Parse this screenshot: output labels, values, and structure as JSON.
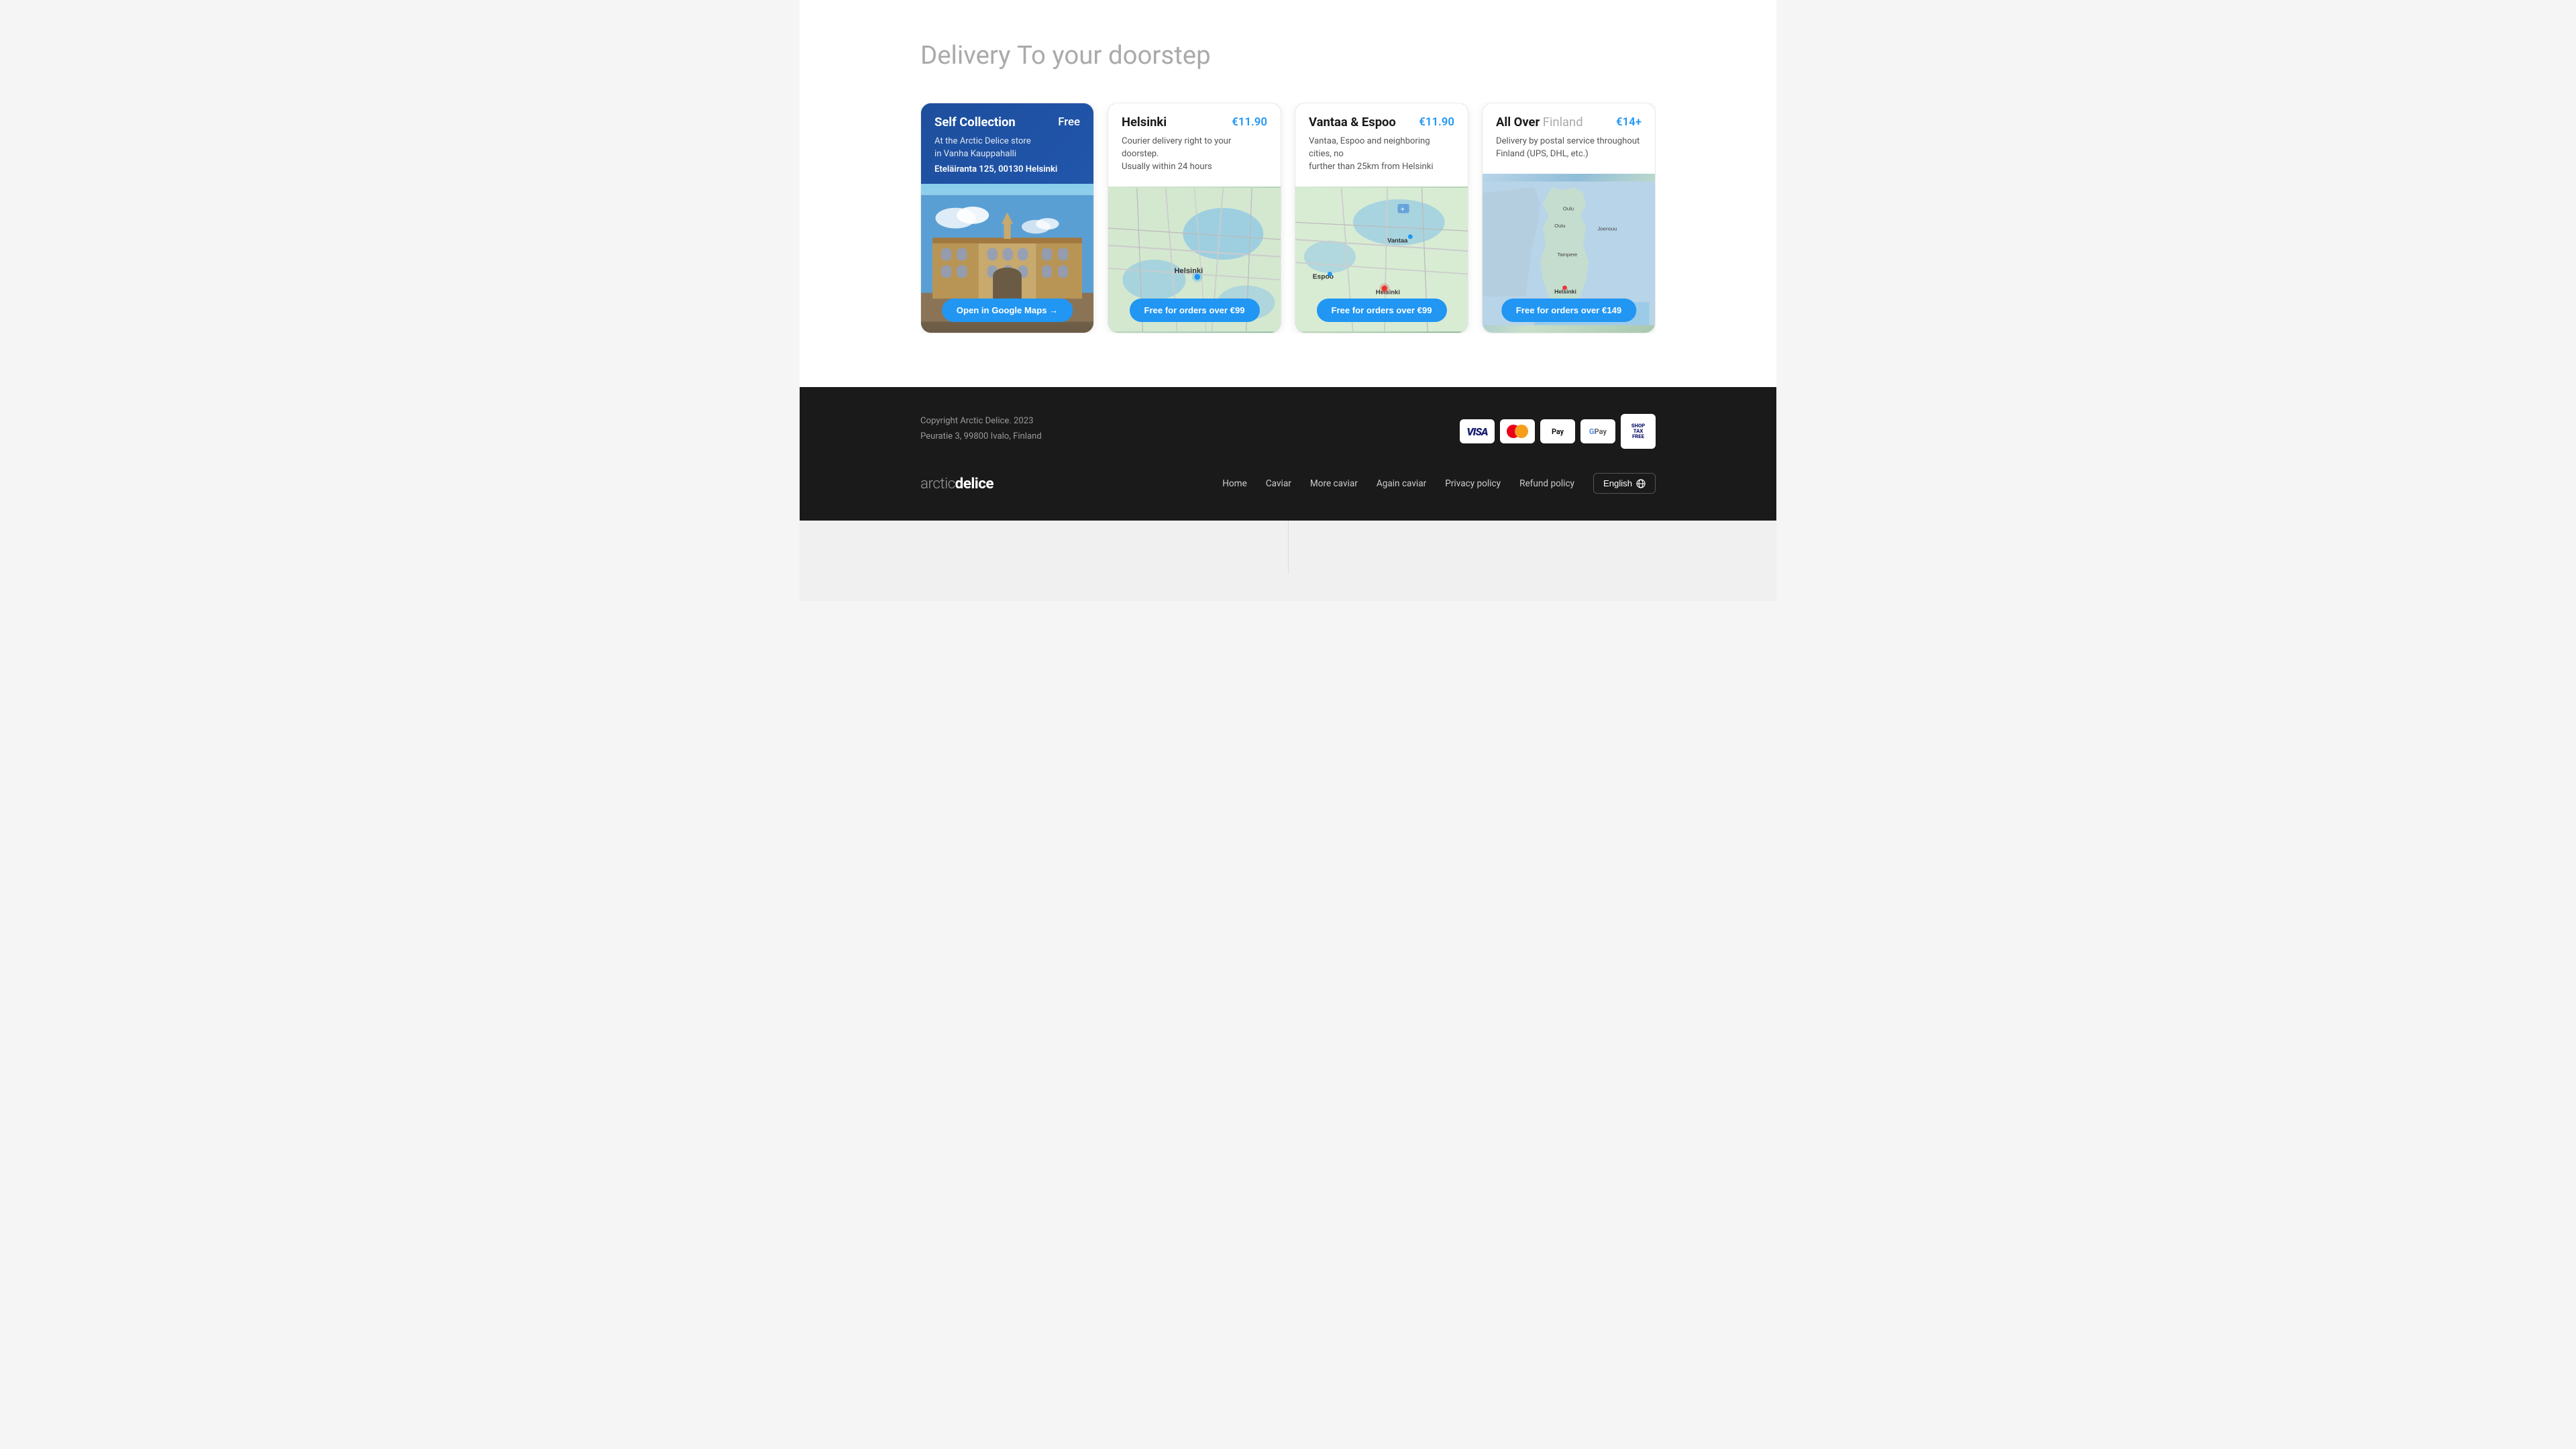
{
  "page": {
    "heading": {
      "bold": "Delivery",
      "light": "To your doorstep"
    }
  },
  "cards": [
    {
      "id": "self-collection",
      "title": "Self Collection",
      "price": "Free",
      "price_type": "free",
      "description_line1": "At the Arctic Delice store",
      "description_line2": "in Vanha Kauppahalli",
      "address": "Eteläiranta 125, 00130 Helsinki",
      "button_label": "Open in Google Maps →",
      "visual_type": "building"
    },
    {
      "id": "helsinki",
      "title": "Helsinki",
      "price": "€11.90",
      "price_type": "paid",
      "description_line1": "Courier delivery right to your doorstep.",
      "description_line2": "Usually within 24 hours",
      "address": "",
      "button_label": "Free for orders over €99",
      "visual_type": "map-helsinki"
    },
    {
      "id": "vantaa-espoo",
      "title": "Vantaa & Espoo",
      "price": "€11.90",
      "price_type": "paid",
      "description_line1": "Vantaa, Espoo and neighboring cities, no",
      "description_line2": "further than 25km from Helsinki",
      "address": "",
      "button_label": "Free for orders over €99",
      "visual_type": "map-vantaa"
    },
    {
      "id": "all-over-finland",
      "title_bold": "All Over",
      "title_light": "Finland",
      "price": "€14+",
      "price_type": "paid",
      "description_line1": "Delivery by postal service throughout",
      "description_line2": "Finland (UPS, DHL, etc.)",
      "address": "",
      "button_label": "Free for orders over €149",
      "visual_type": "map-finland",
      "partial": true
    }
  ],
  "footer": {
    "copyright": "Copyright Arctic Delice. 2023",
    "address": "Peuratie 3, 99800 Ivalo, Finland",
    "logo_light": "arctic",
    "logo_bold": "delice",
    "nav_items": [
      {
        "label": "Home",
        "href": "#"
      },
      {
        "label": "Caviar",
        "href": "#"
      },
      {
        "label": "More caviar",
        "href": "#"
      },
      {
        "label": "Again caviar",
        "href": "#"
      },
      {
        "label": "Privacy policy",
        "href": "#"
      },
      {
        "label": "Refund policy",
        "href": "#"
      }
    ],
    "language_button": "English",
    "payment_methods": [
      {
        "name": "Visa",
        "label": "VISA"
      },
      {
        "name": "Mastercard",
        "label": "MC"
      },
      {
        "name": "Apple Pay",
        "label": "Apple Pay"
      },
      {
        "name": "Google Pay",
        "label": "G Pay"
      }
    ],
    "shop_tax_free": {
      "line1": "SHOP",
      "line2": "TAX",
      "line3": "FREE"
    }
  }
}
